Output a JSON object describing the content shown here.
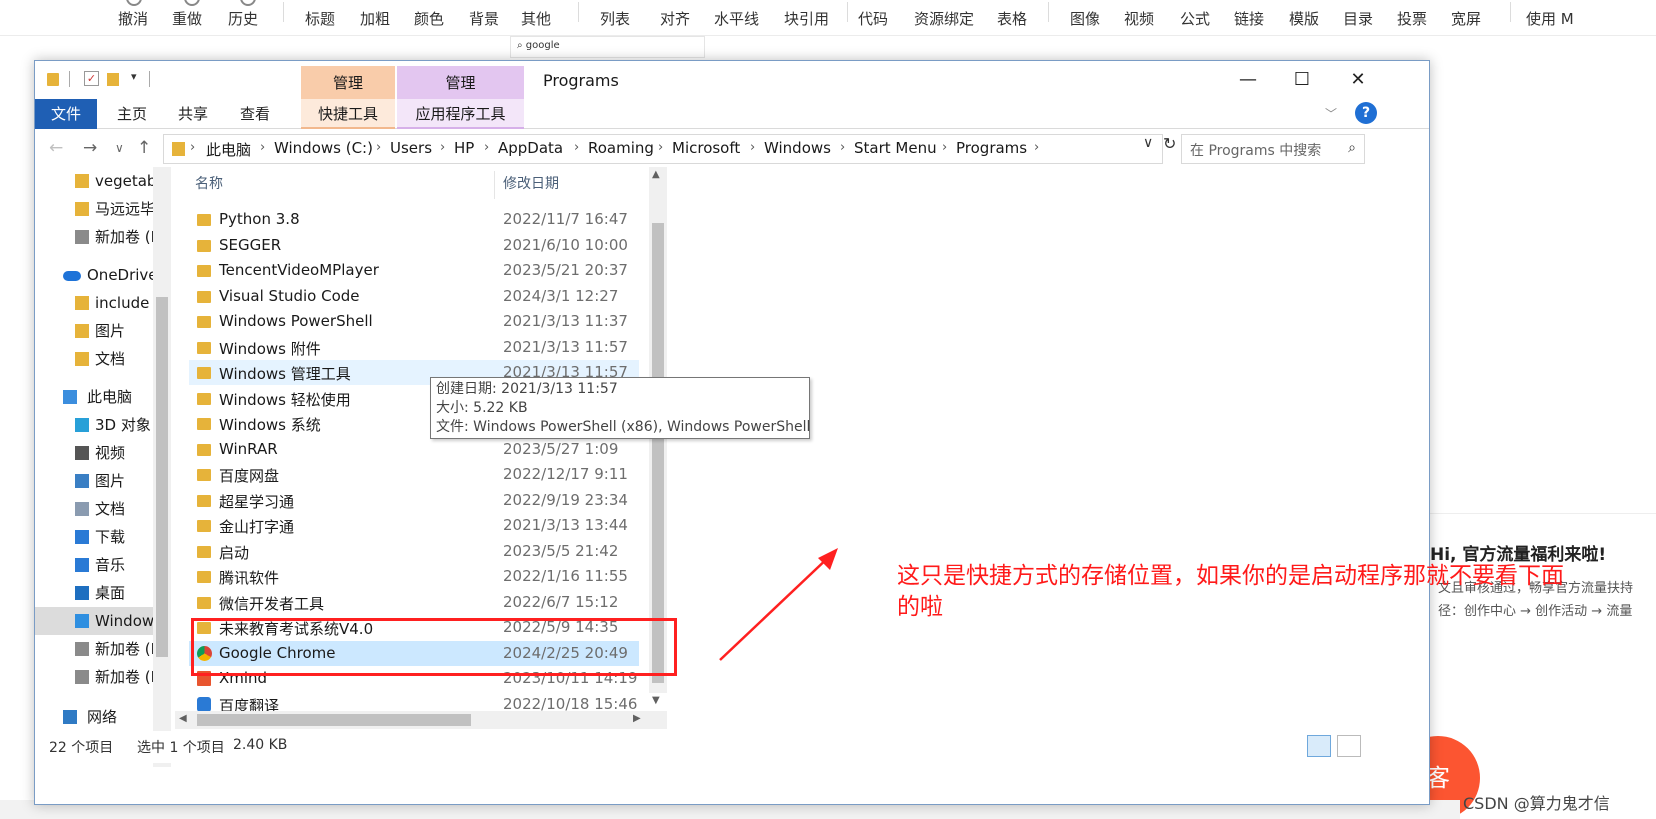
{
  "editor_toolbar": {
    "items": [
      "撤消",
      "重做",
      "历史",
      "标题",
      "加粗",
      "颜色",
      "背景",
      "其他",
      "列表",
      "对齐",
      "水平线",
      "块引用",
      "代码",
      "资源绑定",
      "表格",
      "图像",
      "视频",
      "公式",
      "链接",
      "模版",
      "目录",
      "投票",
      "宽屏",
      "使用 M"
    ]
  },
  "background_page": {
    "search_text": "google",
    "card_title": "Hi, 官方流量福利来啦!",
    "card_line1": "文且审核通过，畅享官方流量扶持",
    "card_line2": "径：创作中心 → 创作活动 → 流量",
    "red_button": "客",
    "watermark": "CSDN @算力鬼才信"
  },
  "window": {
    "title": "Programs",
    "context_group_1": "管理",
    "context_group_2": "管理",
    "controls": {
      "minimize": "—",
      "maximize": "☐",
      "close": "✕"
    }
  },
  "ribbon": {
    "file": "文件",
    "tabs": [
      "主页",
      "共享",
      "查看"
    ],
    "ctx_tab_1": "快捷工具",
    "ctx_tab_2": "应用程序工具",
    "help": "?"
  },
  "address": {
    "crumbs": [
      "此电脑",
      "Windows (C:)",
      "Users",
      "HP",
      "AppData",
      "Roaming",
      "Microsoft",
      "Windows",
      "Start Menu",
      "Programs"
    ],
    "search_placeholder": "在 Programs 中搜索"
  },
  "nav_pane": {
    "items": [
      {
        "label": "vegetables",
        "icon": "folder-icon",
        "indent": 1
      },
      {
        "label": "马远远毕业",
        "icon": "folder-icon",
        "indent": 1
      },
      {
        "label": "新加卷 (D:)",
        "icon": "drive-icon",
        "indent": 1
      },
      {
        "label": "OneDrive",
        "icon": "onedrive-cloud-icon",
        "indent": 0
      },
      {
        "label": "include",
        "icon": "folder-icon",
        "indent": 1
      },
      {
        "label": "图片",
        "icon": "folder-icon",
        "indent": 1
      },
      {
        "label": "文档",
        "icon": "folder-icon",
        "indent": 1
      },
      {
        "label": "此电脑",
        "icon": "computer-icon",
        "indent": 0
      },
      {
        "label": "3D 对象",
        "icon": "3d-objects-icon",
        "indent": 1
      },
      {
        "label": "视频",
        "icon": "video-icon",
        "indent": 1
      },
      {
        "label": "图片",
        "icon": "pictures-icon",
        "indent": 1
      },
      {
        "label": "文档",
        "icon": "documents-icon",
        "indent": 1
      },
      {
        "label": "下载",
        "icon": "download-icon",
        "indent": 1
      },
      {
        "label": "音乐",
        "icon": "music-icon",
        "indent": 1
      },
      {
        "label": "桌面",
        "icon": "desktop-icon",
        "indent": 1
      },
      {
        "label": "Windows (C:)",
        "icon": "windows-drive-icon",
        "indent": 1
      },
      {
        "label": "新加卷 (D:)",
        "icon": "drive-icon",
        "indent": 1
      },
      {
        "label": "新加卷 (E:)",
        "icon": "drive-icon",
        "indent": 1
      },
      {
        "label": "网络",
        "icon": "network-icon",
        "indent": 0
      }
    ]
  },
  "file_list": {
    "columns": {
      "name": "名称",
      "date": "修改日期"
    },
    "rows": [
      {
        "name": "Python 3.8",
        "date": "2022/11/7 16:47",
        "icon": "folder-icon"
      },
      {
        "name": "SEGGER",
        "date": "2021/6/10 10:00",
        "icon": "folder-icon"
      },
      {
        "name": "TencentVideoMPlayer",
        "date": "2023/5/21 20:37",
        "icon": "folder-icon"
      },
      {
        "name": "Visual Studio Code",
        "date": "2024/3/1 12:27",
        "icon": "folder-icon"
      },
      {
        "name": "Windows PowerShell",
        "date": "2021/3/13 11:37",
        "icon": "folder-icon"
      },
      {
        "name": "Windows 附件",
        "date": "2021/3/13 11:57",
        "icon": "folder-icon"
      },
      {
        "name": "Windows 管理工具",
        "date": "2021/3/13 11:57",
        "icon": "folder-icon"
      },
      {
        "name": "Windows 轻松使用",
        "date": "",
        "icon": "folder-icon"
      },
      {
        "name": "Windows 系统",
        "date": "",
        "icon": "folder-icon"
      },
      {
        "name": "WinRAR",
        "date": "2023/5/27 1:09",
        "icon": "folder-icon"
      },
      {
        "name": "百度网盘",
        "date": "2022/12/17 9:11",
        "icon": "folder-icon"
      },
      {
        "name": "超星学习通",
        "date": "2022/9/19 23:34",
        "icon": "folder-icon"
      },
      {
        "name": "金山打字通",
        "date": "2021/3/13 13:44",
        "icon": "folder-icon"
      },
      {
        "name": "启动",
        "date": "2023/5/5 21:42",
        "icon": "folder-icon"
      },
      {
        "name": "腾讯软件",
        "date": "2022/1/16 11:55",
        "icon": "folder-icon"
      },
      {
        "name": "微信开发者工具",
        "date": "2022/6/7 15:12",
        "icon": "folder-icon"
      },
      {
        "name": "未来教育考试系统V4.0",
        "date": "2022/5/9 14:35",
        "icon": "folder-icon"
      },
      {
        "name": "Google Chrome",
        "date": "2024/2/25 20:49",
        "icon": "chrome-icon"
      },
      {
        "name": "Xmind",
        "date": "2023/10/11 14:19",
        "icon": "xmind-icon"
      },
      {
        "name": "百度翻译",
        "date": "2022/10/18 15:46",
        "icon": "baidu-translate-icon"
      }
    ]
  },
  "tooltip": {
    "line1": "创建日期: 2021/3/13 11:57",
    "line2": "大小: 5.22 KB",
    "line3": "文件: Windows PowerShell (x86), Windows PowerShell"
  },
  "status": {
    "count": "22 个项目",
    "selected": "选中 1 个项目",
    "size": "2.40 KB"
  },
  "annotation": {
    "text": "这只是快捷方式的存储位置，如果你的是启动程序那就不要看下面的啦",
    "color": "#ff1a1a"
  }
}
